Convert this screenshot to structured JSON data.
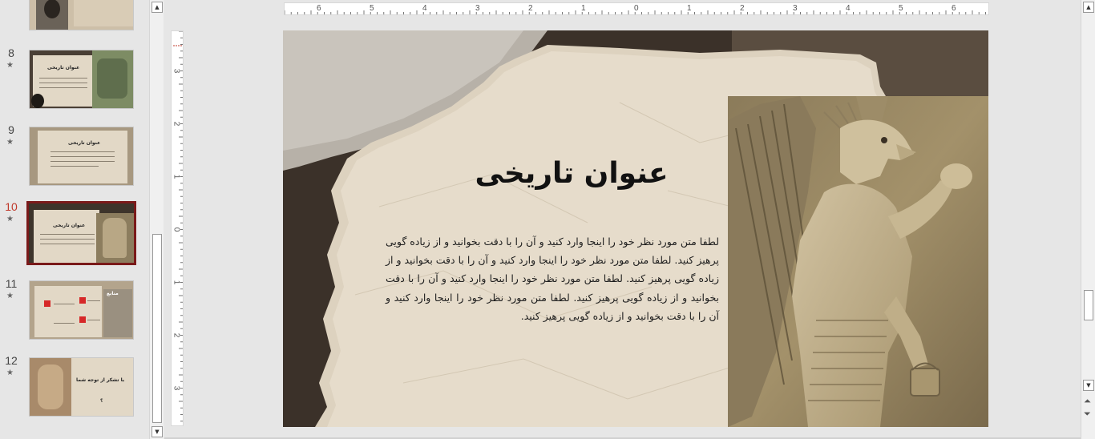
{
  "thumbnails": [
    {
      "number": "",
      "star": ""
    },
    {
      "number": "8",
      "star": "★",
      "title": "عنوان تاریخی"
    },
    {
      "number": "9",
      "star": "★",
      "title": "عنوان تاریخی"
    },
    {
      "number": "10",
      "star": "★",
      "title": "عنوان تاریخی"
    },
    {
      "number": "11",
      "star": "★",
      "title": "منابع"
    },
    {
      "number": "12",
      "star": "★",
      "title": "با تشکر از توجه شما",
      "subtitle": "؟"
    }
  ],
  "ruler_h": [
    "6",
    "5",
    "4",
    "3",
    "2",
    "1",
    "0",
    "1",
    "2",
    "3",
    "4",
    "5",
    "6"
  ],
  "ruler_v": [
    "3",
    "2",
    "1",
    "0",
    "1",
    "2",
    "3"
  ],
  "slide": {
    "title": "عنوان تاریخی",
    "body": "لطفا متن مورد نظر خود را اینجا وارد کنید و آن را با دقت بخوانید و از زیاده گویی پرهیز کنید. لطفا متن مورد نظر خود را اینجا وارد کنید و آن را با دقت بخوانید و از زیاده گویی پرهیز کنید. لطفا متن مورد نظر خود را اینجا وارد کنید و آن را با دقت بخوانید و از زیاده گویی پرهیز کنید. لطفا متن مورد نظر خود را اینجا وارد کنید و آن را با دقت بخوانید و از زیاده گویی پرهیز کنید."
  },
  "icons": {
    "scroll_up": "▲",
    "scroll_down": "▼",
    "prev_slide": "⏶",
    "next_slide": "⏷"
  },
  "colors": {
    "selected_border": "#7a1a1a",
    "selected_number": "#c0392b",
    "paper": "#e2d8c6"
  }
}
